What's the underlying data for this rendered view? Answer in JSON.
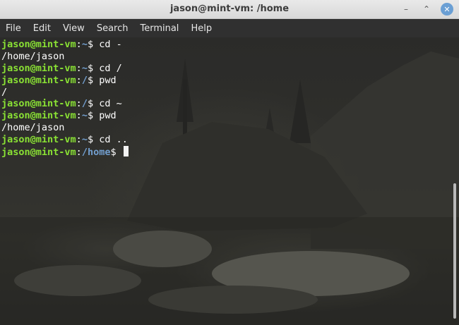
{
  "window": {
    "title": "jason@mint-vm: /home",
    "minimize_icon": "minimize-icon",
    "maximize_icon": "maximize-icon",
    "close_icon": "close-icon"
  },
  "menu": {
    "items": [
      {
        "label": "File"
      },
      {
        "label": "Edit"
      },
      {
        "label": "View"
      },
      {
        "label": "Search"
      },
      {
        "label": "Terminal"
      },
      {
        "label": "Help"
      }
    ]
  },
  "terminal": {
    "lines": [
      {
        "type": "prompt",
        "user": "jason@mint-vm",
        "sep": ":",
        "path": "~",
        "sign": "$ ",
        "cmd": "cd -"
      },
      {
        "type": "output",
        "text": "/home/jason"
      },
      {
        "type": "prompt",
        "user": "jason@mint-vm",
        "sep": ":",
        "path": "~",
        "sign": "$ ",
        "cmd": "cd /"
      },
      {
        "type": "prompt",
        "user": "jason@mint-vm",
        "sep": ":",
        "path": "/",
        "sign": "$ ",
        "cmd": "pwd"
      },
      {
        "type": "output",
        "text": "/"
      },
      {
        "type": "prompt",
        "user": "jason@mint-vm",
        "sep": ":",
        "path": "/",
        "sign": "$ ",
        "cmd": "cd ~"
      },
      {
        "type": "prompt",
        "user": "jason@mint-vm",
        "sep": ":",
        "path": "~",
        "sign": "$ ",
        "cmd": "pwd"
      },
      {
        "type": "output",
        "text": "/home/jason"
      },
      {
        "type": "prompt",
        "user": "jason@mint-vm",
        "sep": ":",
        "path": "~",
        "sign": "$ ",
        "cmd": "cd .."
      },
      {
        "type": "prompt",
        "user": "jason@mint-vm",
        "sep": ":",
        "path": "/home",
        "sign": "$ ",
        "cmd": "",
        "cursor": true
      }
    ],
    "colors": {
      "user": "#8ae234",
      "path": "#729fcf",
      "text": "#ffffff"
    }
  }
}
